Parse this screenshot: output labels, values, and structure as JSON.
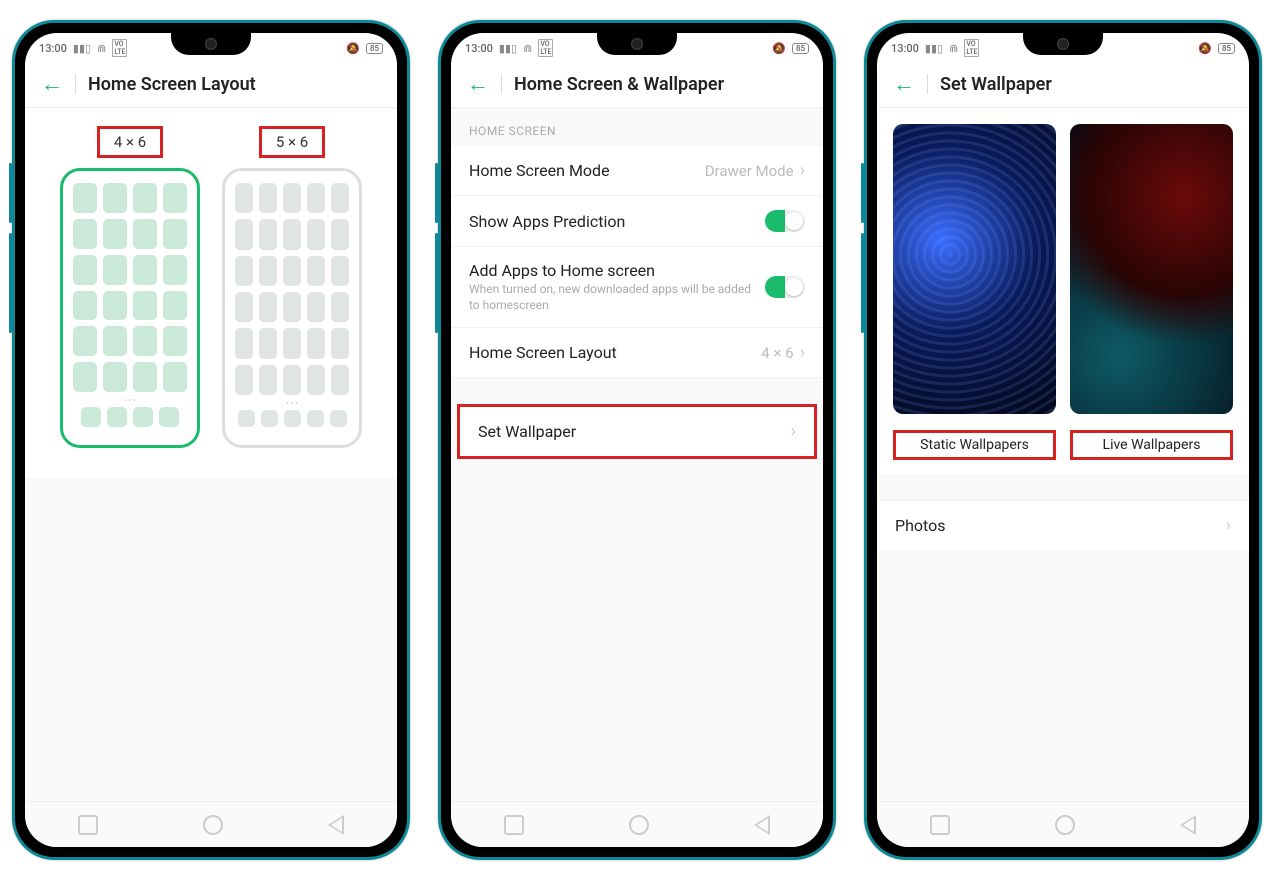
{
  "statusbar": {
    "time": "13:00",
    "battery": "85"
  },
  "screen1": {
    "title": "Home Screen Layout",
    "option_a": "4 × 6",
    "option_b": "5 × 6"
  },
  "screen2": {
    "title": "Home Screen & Wallpaper",
    "section": "HOME SCREEN",
    "mode_label": "Home Screen Mode",
    "mode_value": "Drawer Mode",
    "prediction_label": "Show Apps Prediction",
    "addapps_label": "Add Apps to Home screen",
    "addapps_sub": "When turned on, new downloaded apps will be added to homescreen",
    "layout_label": "Home Screen Layout",
    "layout_value": "4 × 6",
    "setwallpaper_label": "Set Wallpaper"
  },
  "screen3": {
    "title": "Set Wallpaper",
    "static_label": "Static Wallpapers",
    "live_label": "Live Wallpapers",
    "photos_label": "Photos"
  }
}
